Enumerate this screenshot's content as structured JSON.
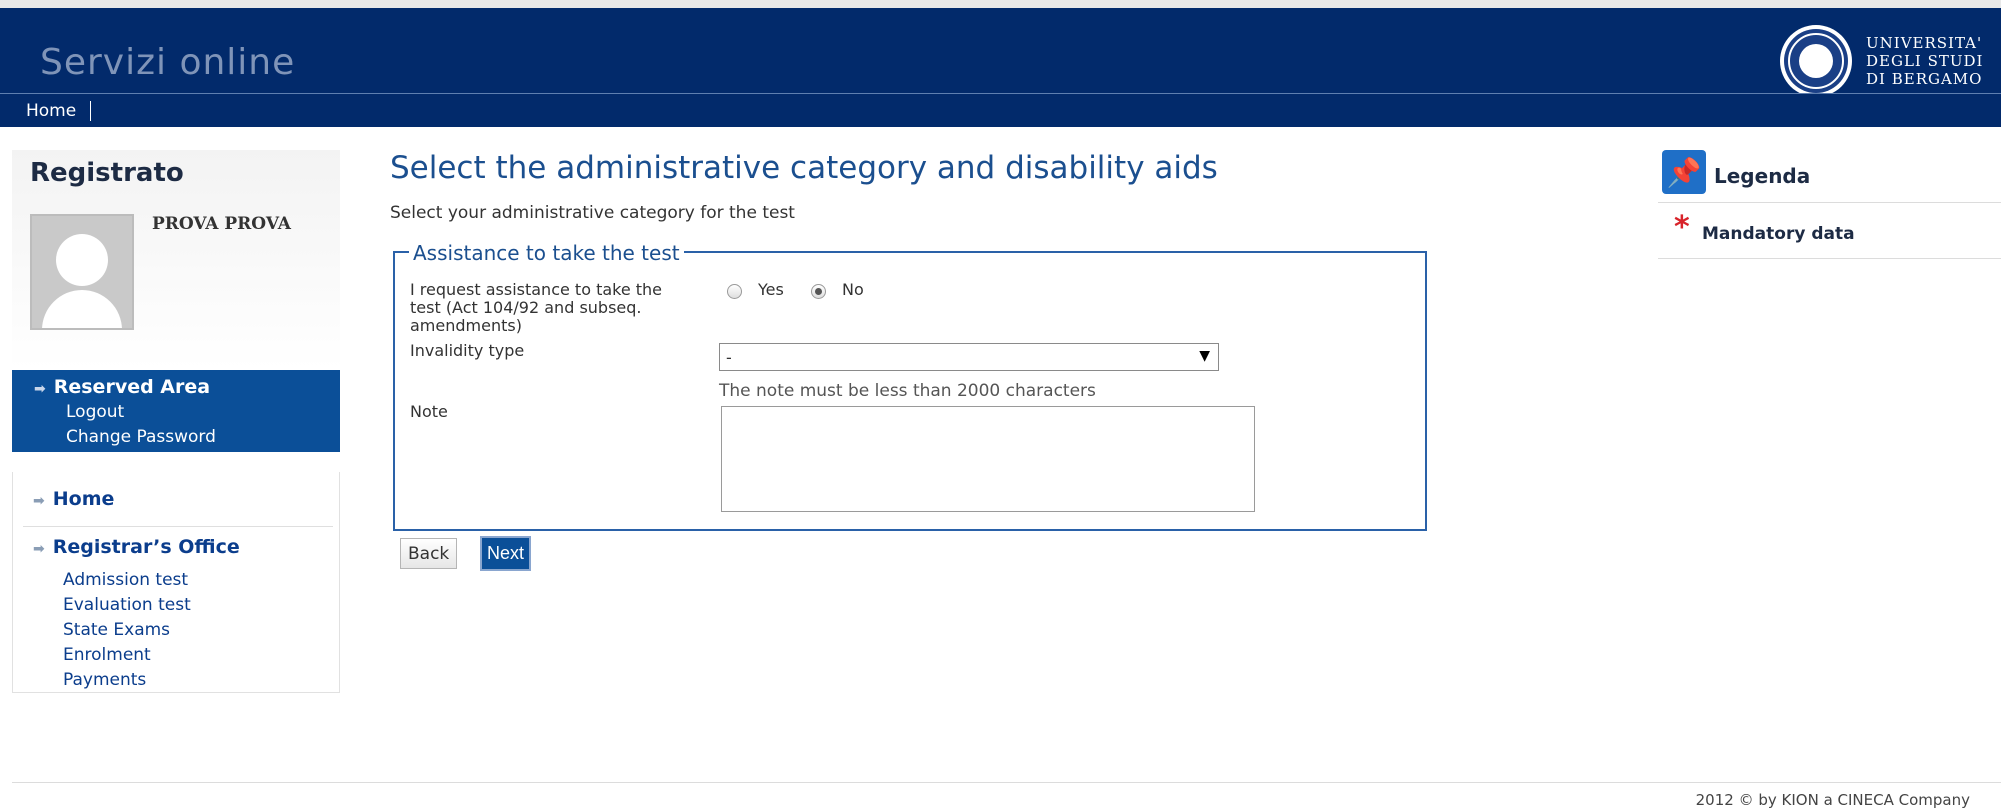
{
  "header": {
    "site_title": "Servizi online",
    "logo_line1": "UNIVERSITA'",
    "logo_line2": "DEGLI STUDI",
    "logo_line3": "DI BERGAMO"
  },
  "navbar": {
    "home": "Home"
  },
  "sidebar": {
    "title": "Registrato",
    "username": "PROVA PROVA",
    "reserved_area": "Reserved Area",
    "logout": "Logout",
    "change_password": "Change Password",
    "home": "Home",
    "registrar_office": "Registrar’s Office",
    "links": [
      "Admission test",
      "Evaluation test",
      "State Exams",
      "Enrolment",
      "Payments"
    ]
  },
  "main": {
    "title": "Select the administrative category and disability aids",
    "subtitle": "Select your administrative category for the test",
    "fieldset_legend": "Assistance to take the test",
    "assistance_label_1": "I request assistance to take the",
    "assistance_label_2": "test (Act 104/92 and subseq.",
    "assistance_label_3": "amendments)",
    "radio_yes": "Yes",
    "radio_no": "No",
    "radio_selected": "No",
    "invalidity_label": "Invalidity type",
    "invalidity_value": "-",
    "note_hint": "The note must be less than 2000 characters",
    "note_label": "Note",
    "note_value": "",
    "back_button": "Back",
    "next_button": "Next"
  },
  "legend": {
    "title": "Legenda",
    "mandatory": "Mandatory data"
  },
  "footer": {
    "text": "2012 © by KION a CINECA Company"
  },
  "colors": {
    "header_bg": "#022a6b",
    "accent": "#0b4f98",
    "required": "#d8232a"
  }
}
